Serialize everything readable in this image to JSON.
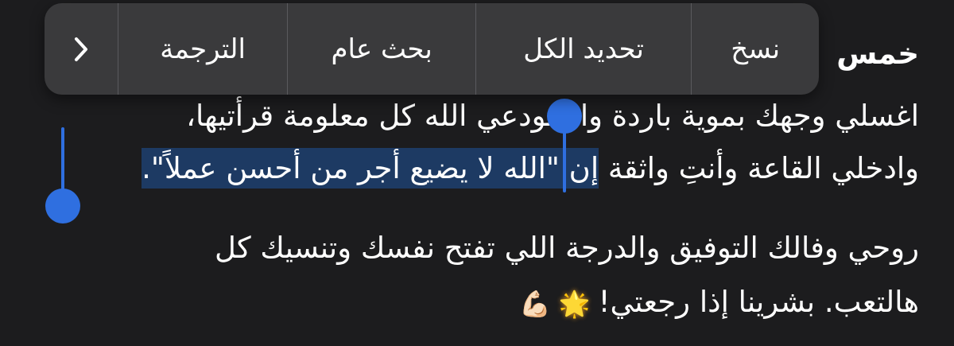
{
  "context_menu": {
    "more_icon": "chevron-right-icon",
    "items": [
      {
        "label": "نسخ"
      },
      {
        "label": "تحديد الكل"
      },
      {
        "label": "بحث عام"
      },
      {
        "label": "الترجمة"
      }
    ]
  },
  "message": {
    "line1_visible": "خمس",
    "line2": "اغسلي وجهك بموية باردة واستودعي الله كل معلومة قرأتيها،",
    "line3_before": "وادخلي القاعة وأنتِ واثقة ",
    "line3_selected": "إن \"الله لا يضيع أجر من أحسن عملاً\".",
    "line4": "روحي وفالك التوفيق والدرجة اللي تفتح نفسك وتنسيك كل",
    "line5": "هالتعب. بشرينا إذا رجعتي!",
    "emoji_1": "🌟",
    "emoji_2": "💪🏻"
  },
  "colors": {
    "background": "#1c1c1e",
    "menu_background": "#3a3a3c",
    "selection_highlight": "#1d3a63",
    "selection_handle": "#2f6fe0",
    "text": "#ffffff"
  }
}
